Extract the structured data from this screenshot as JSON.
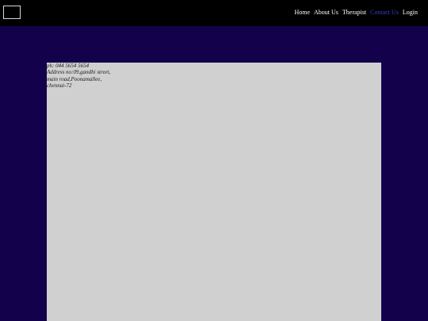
{
  "nav": {
    "items": [
      {
        "label": "Home",
        "active": false
      },
      {
        "label": "About Us",
        "active": false
      },
      {
        "label": "Therapist",
        "active": false
      },
      {
        "label": "Contact Us",
        "active": true
      },
      {
        "label": "Login",
        "active": false
      }
    ]
  },
  "contact": {
    "phone": "ph: 044 5654 5654",
    "address_line1": "Address no:09,gandhi street,",
    "address_line2": "main road,Poonamallee,",
    "address_line3": "chennai-72"
  },
  "colors": {
    "page_background": "#13024b",
    "topbar": "#000000",
    "panel": "#d1d0d1",
    "nav_active": "#3a3ad6"
  }
}
